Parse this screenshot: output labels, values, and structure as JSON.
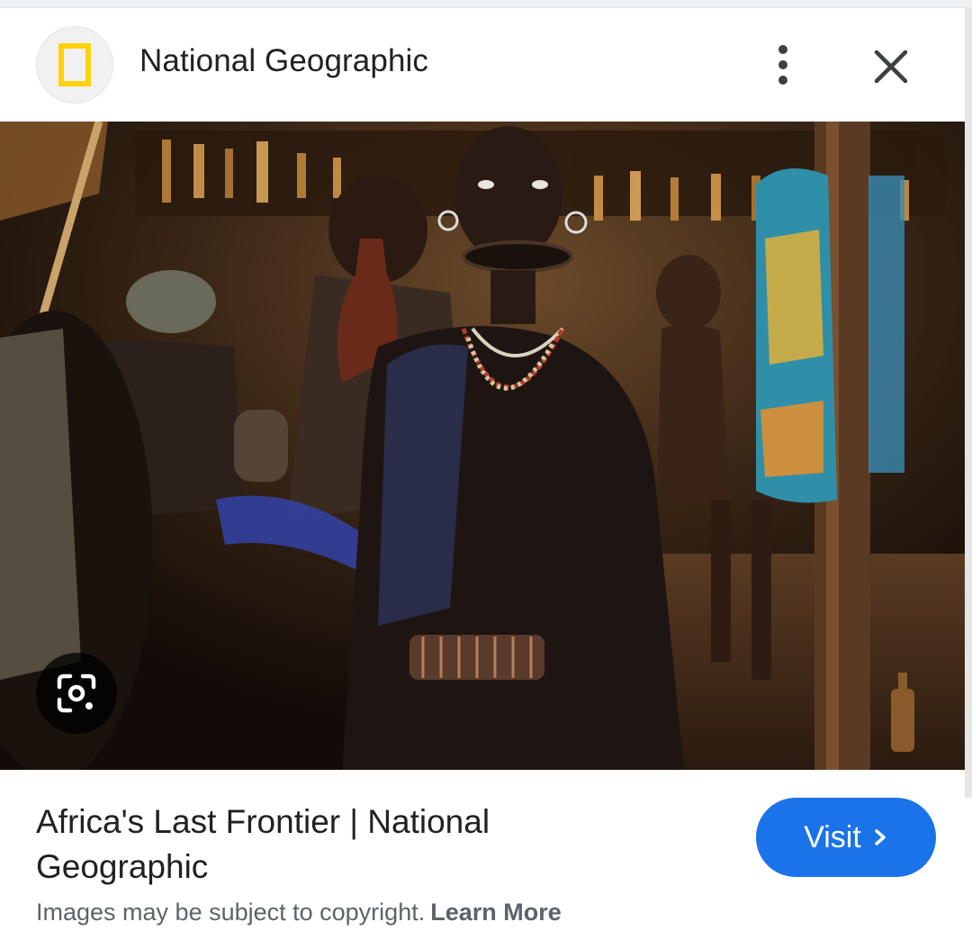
{
  "header": {
    "site_name": "National Geographic",
    "logo_icon": "national-geographic-yellow-rectangle",
    "more_icon": "more-vert-icon",
    "close_icon": "close-icon",
    "logo_color": "#ffd20a"
  },
  "image": {
    "lens_icon": "google-lens-icon"
  },
  "footer": {
    "title": "Africa's Last Frontier | National Geographic",
    "visit_label": "Visit",
    "visit_icon": "chevron-right-icon",
    "copyright_text": "Images may be subject to copyright.",
    "learn_more_label": "Learn More",
    "accent_color": "#1a73e8"
  }
}
